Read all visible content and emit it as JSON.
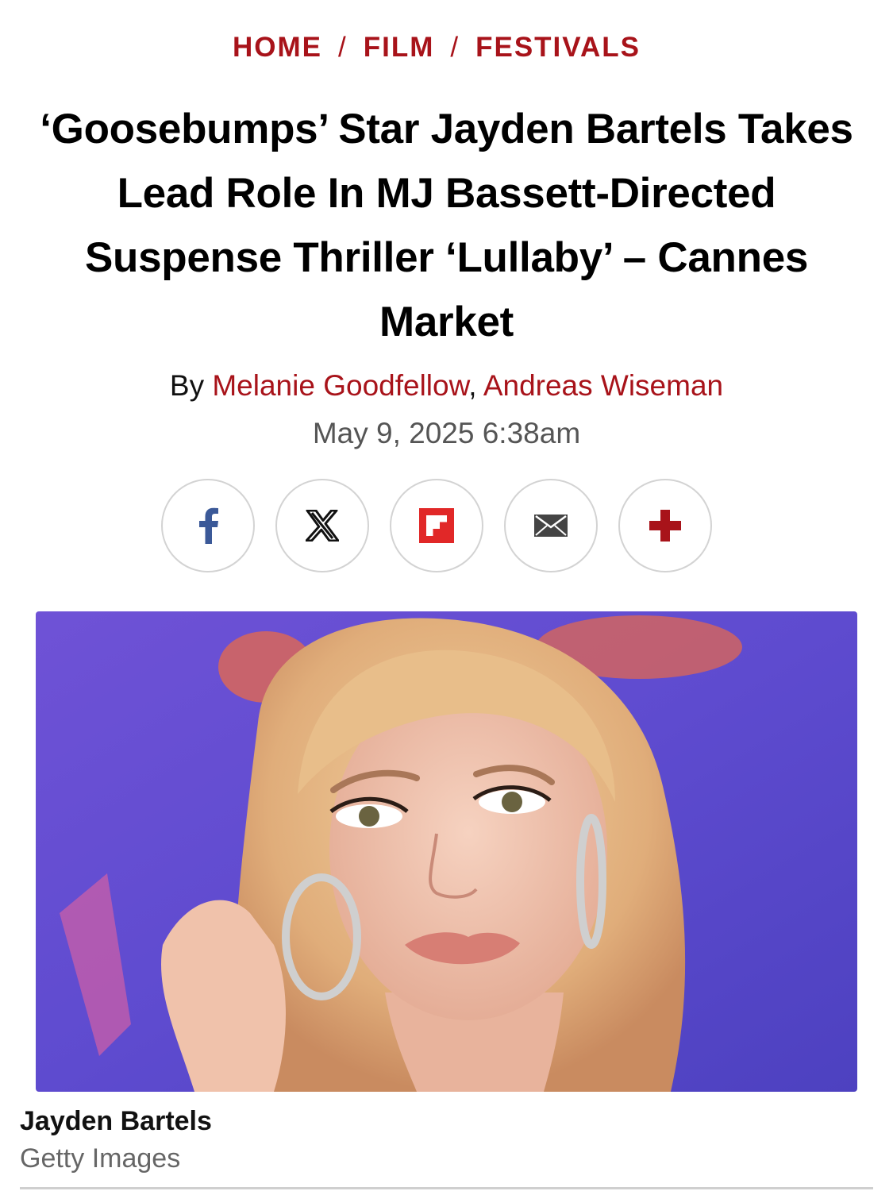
{
  "breadcrumb": {
    "items": [
      "HOME",
      "FILM",
      "FESTIVALS"
    ],
    "separator": "/"
  },
  "article": {
    "headline": "‘Goosebumps’ Star Jayden Bartels Takes Lead Role In MJ Bassett-Directed Suspense Thriller ‘Lullaby’ – Cannes Market",
    "by_prefix": "By",
    "authors": [
      "Melanie Goodfellow",
      "Andreas Wiseman"
    ],
    "author_separator": ",",
    "date": "May 9, 2025 6:38am"
  },
  "share": {
    "buttons": [
      "facebook-icon",
      "x-icon",
      "flipboard-icon",
      "email-icon",
      "plus-icon"
    ]
  },
  "image": {
    "caption": "Jayden Bartels",
    "credit": "Getty Images"
  },
  "colors": {
    "accent": "#a8131a",
    "facebook": "#3b5998",
    "flipboard": "#e12828",
    "muted": "#666666",
    "border": "#d3d3d3"
  }
}
